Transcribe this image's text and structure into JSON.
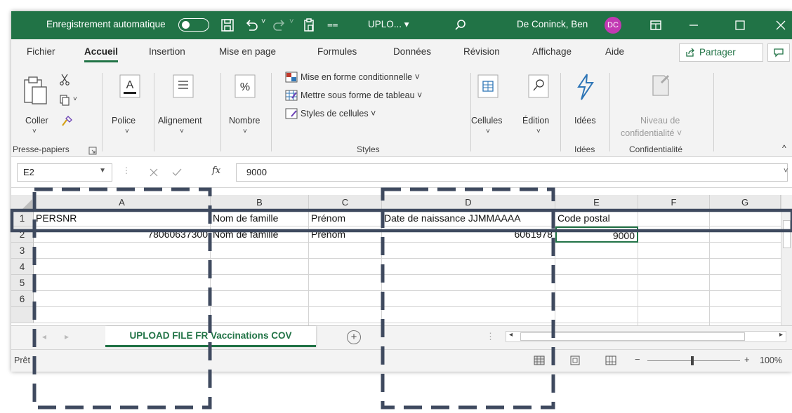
{
  "titlebar": {
    "autosave_label": "Enregistrement automatique",
    "filename": "UPLO... ▾",
    "user_name": "De Coninck, Ben",
    "user_initials": "DC",
    "accent": "#217346"
  },
  "menu": {
    "tabs": [
      "Fichier",
      "Accueil",
      "Insertion",
      "Mise en page",
      "Formules",
      "Données",
      "Révision",
      "Affichage",
      "Aide"
    ],
    "active_tab": "Accueil",
    "share_label": "Partager"
  },
  "ribbon": {
    "coller": "Coller",
    "police": "Police",
    "alignement": "Alignement",
    "nombre": "Nombre",
    "cond_format": "Mise en forme conditionnelle ˅",
    "format_table": "Mettre sous forme de tableau ˅",
    "cell_styles": "Styles de cellules ˅",
    "cellules": "Cellules",
    "edition": "Édition",
    "idees": "Idées",
    "niveau": "Niveau de",
    "confidentialite_btn": "confidentialité ˅",
    "groups": {
      "presse_papiers": "Presse-papiers",
      "styles": "Styles",
      "idees": "Idées",
      "confidentialite": "Confidentialité"
    }
  },
  "formula_bar": {
    "name_box": "E2",
    "fx": "fx",
    "value": "9000"
  },
  "sheet": {
    "columns": [
      "A",
      "B",
      "C",
      "D",
      "E",
      "F",
      "G"
    ],
    "rows": [
      "1",
      "2",
      "3",
      "4",
      "5",
      "6"
    ],
    "row1": {
      "a": "PERSNR",
      "b": "Nom de famille",
      "c": "Prénom",
      "d": "Date de naissance JJMMAAAA",
      "e": "Code postal"
    },
    "row2": {
      "a": "78060637300",
      "b": "Nom de famille",
      "c": "Prénom",
      "d": "6061978",
      "e": "9000"
    }
  },
  "tabs": {
    "sheet_name": "UPLOAD FILE FR Vaccinations COV",
    "add_sheet": "+"
  },
  "status": {
    "ready": "Prêt",
    "zoom": "100%"
  },
  "annotation_color": "#3f4a5f"
}
